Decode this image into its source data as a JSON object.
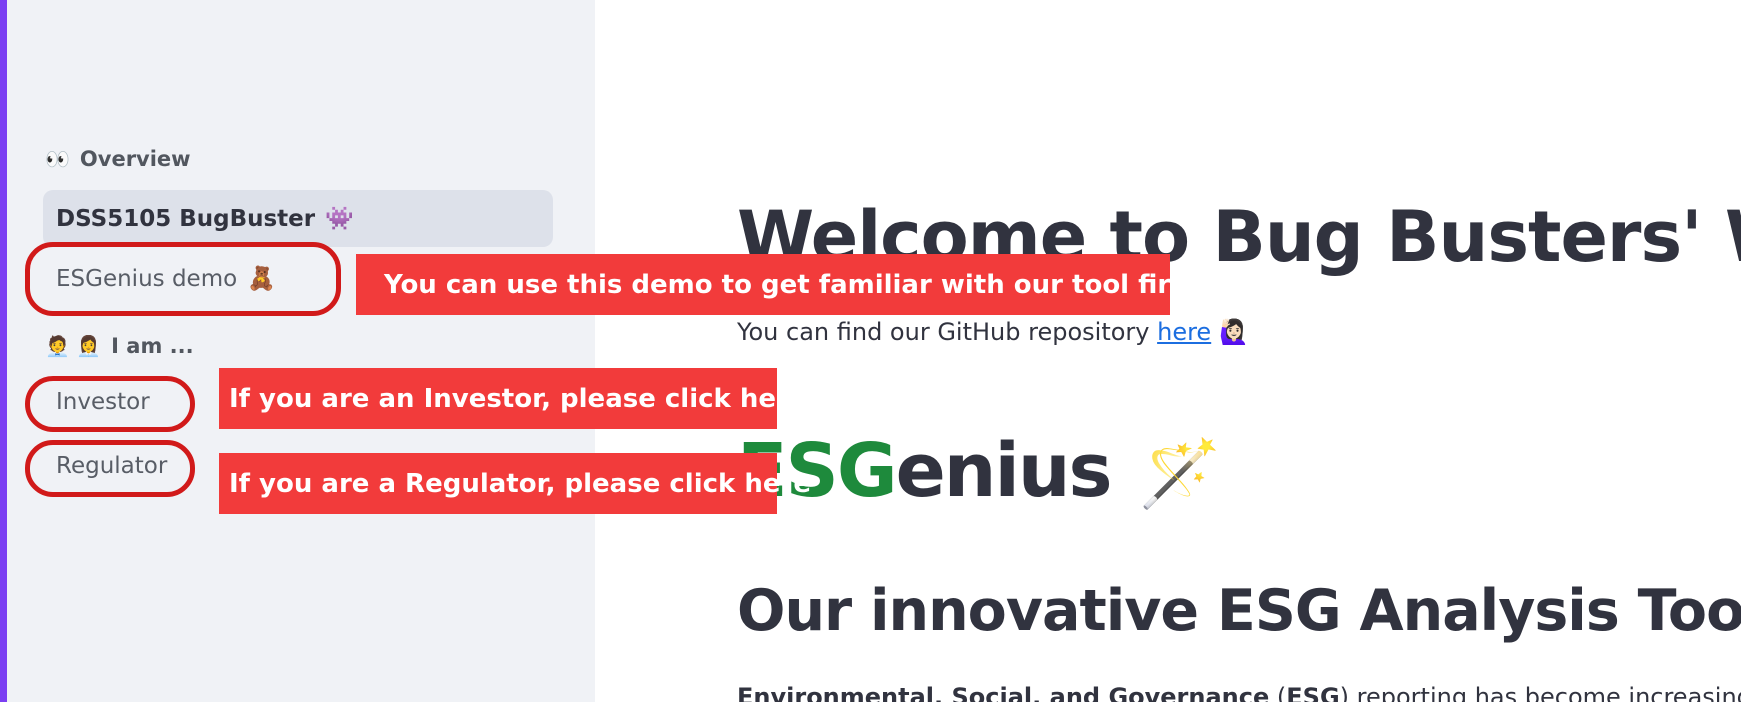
{
  "sidebar": {
    "overview": {
      "emoji": "👀",
      "label": "Overview"
    },
    "active_page": {
      "label": "DSS5105 BugBuster",
      "emoji": "👾"
    },
    "demo": {
      "label": "ESGenius demo",
      "emoji": "🧸"
    },
    "iam": {
      "emoji": "🧑‍💼 👩‍💼",
      "label": "I am ..."
    },
    "investor": {
      "label": "Investor"
    },
    "regulator": {
      "label": "Regulator"
    }
  },
  "callouts": {
    "demo": "You can use this demo to get familiar with our tool first",
    "investor": "If you are an Investor, please click here",
    "regulator": "If you are a Regulator, please click here"
  },
  "main": {
    "welcome_title": "Welcome to Bug Busters' Worl",
    "repo_prefix": "You can find our GitHub repository ",
    "repo_link": "here",
    "repo_emoji": "🙋🏻‍♀️",
    "brand_esg": "ESG",
    "brand_rest": "enius",
    "brand_emoji": "🪄",
    "tool_title": "Our innovative ESG Analysis Tool",
    "tool_emoji": "📊",
    "intro_bold": "Environmental, Social, and Governance",
    "intro_mid": " (",
    "intro_bold2": "ESG",
    "intro_rest": ") reporting has become increasingly cru"
  },
  "colors": {
    "sidebar_bg": "#f0f2f6",
    "active_bg": "#dde1ea",
    "ring": "#d11a1a",
    "callout_bg": "#f23b3b",
    "esg_green": "#1e8a3c",
    "link": "#1c6ee0"
  }
}
